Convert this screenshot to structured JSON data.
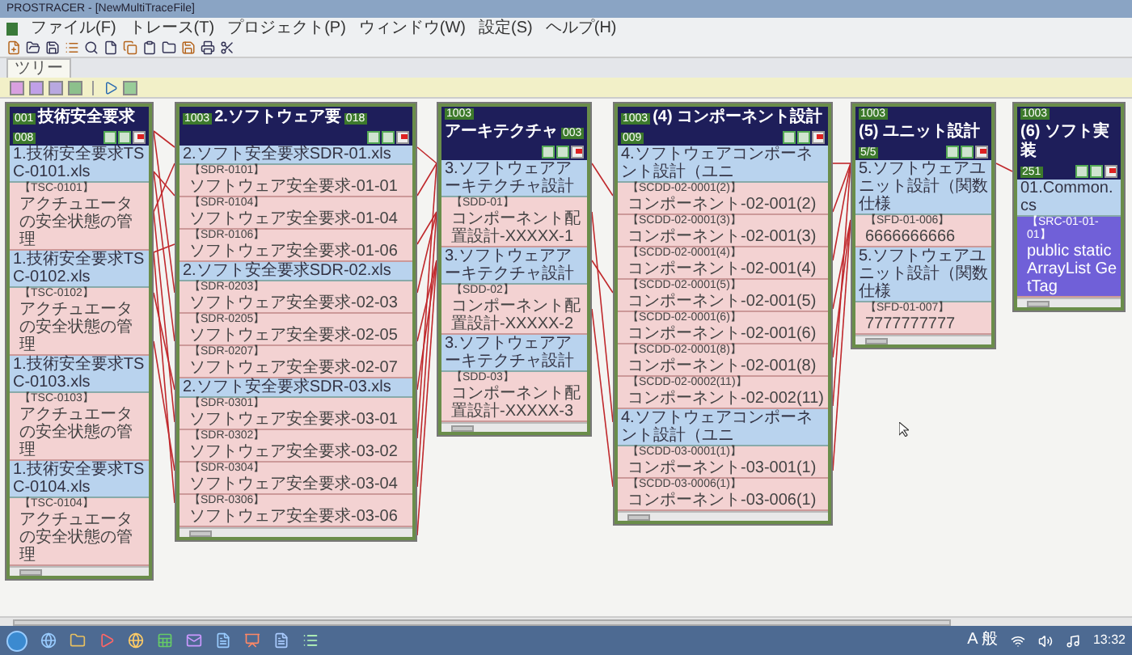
{
  "window": {
    "title": "PROSTRACER - [NewMultiTraceFile]"
  },
  "menu": [
    "ファイル(F)",
    "トレース(T)",
    "プロジェクト(P)",
    "ウィンドウ(W)",
    "設定(S)",
    "ヘルプ(H)"
  ],
  "tabs": [
    {
      "label": "ツリー",
      "selected": true
    }
  ],
  "panels": [
    {
      "badge": "001",
      "title": "技術安全要求",
      "count": "008",
      "groups": [
        {
          "label": "1.技術安全要求TSC-0101.xls",
          "items": [
            {
              "id": "【TSC-0101】",
              "name": "アクチュエータの安全状態の管理",
              "selected": false
            }
          ]
        },
        {
          "label": "1.技術安全要求TSC-0102.xls",
          "items": [
            {
              "id": "【TSC-0102】",
              "name": "アクチュエータの安全状態の管理",
              "selected": false
            }
          ]
        },
        {
          "label": "1.技術安全要求TSC-0103.xls",
          "items": [
            {
              "id": "【TSC-0103】",
              "name": "アクチュエータの安全状態の管理",
              "selected": false
            }
          ]
        },
        {
          "label": "1.技術安全要求TSC-0104.xls",
          "items": [
            {
              "id": "【TSC-0104】",
              "name": "アクチュエータの安全状態の管理",
              "selected": false
            }
          ]
        }
      ]
    },
    {
      "badge": "1003",
      "title": "2.ソフトウェア要",
      "count": "018",
      "groups": [
        {
          "label": "2.ソフト安全要求SDR-01.xls",
          "items": [
            {
              "id": "【SDR-0101】",
              "name": "ソフトウェア安全要求-01-01",
              "selected": false
            },
            {
              "id": "【SDR-0104】",
              "name": "ソフトウェア安全要求-01-04",
              "selected": false
            },
            {
              "id": "【SDR-0106】",
              "name": "ソフトウェア安全要求-01-06",
              "selected": false
            }
          ]
        },
        {
          "label": "2.ソフト安全要求SDR-02.xls",
          "items": [
            {
              "id": "【SDR-0203】",
              "name": "ソフトウェア安全要求-02-03",
              "selected": false
            },
            {
              "id": "【SDR-0205】",
              "name": "ソフトウェア安全要求-02-05",
              "selected": false
            },
            {
              "id": "【SDR-0207】",
              "name": "ソフトウェア安全要求-02-07",
              "selected": false
            }
          ]
        },
        {
          "label": "2.ソフト安全要求SDR-03.xls",
          "items": [
            {
              "id": "【SDR-0301】",
              "name": "ソフトウェア安全要求-03-01",
              "selected": false
            },
            {
              "id": "【SDR-0302】",
              "name": "ソフトウェア安全要求-03-02",
              "selected": false
            },
            {
              "id": "【SDR-0304】",
              "name": "ソフトウェア安全要求-03-04",
              "selected": false
            },
            {
              "id": "【SDR-0306】",
              "name": "ソフトウェア安全要求-03-06",
              "selected": false
            }
          ]
        }
      ]
    },
    {
      "badge": "1003",
      "title": "アーキテクチャ",
      "count": "003",
      "groups": [
        {
          "label": "3.ソフトウェアアーキテクチャ設計",
          "items": [
            {
              "id": "【SDD-01】",
              "name": "コンポーネント配置設計-XXXXX-1",
              "selected": false
            }
          ]
        },
        {
          "label": "3.ソフトウェアアーキテクチャ設計",
          "items": [
            {
              "id": "【SDD-02】",
              "name": "コンポーネント配置設計-XXXXX-2",
              "selected": false
            }
          ]
        },
        {
          "label": "3.ソフトウェアアーキテクチャ設計",
          "items": [
            {
              "id": "【SDD-03】",
              "name": "コンポーネント配置設計-XXXXX-3",
              "selected": false
            }
          ]
        }
      ]
    },
    {
      "badge": "1003",
      "title": "(4) コンポーネント設計",
      "count": "009",
      "groups": [
        {
          "label": "4.ソフトウェアコンポーネント設計（ユニ",
          "items": [
            {
              "id": "【SCDD-02-0001(2)】",
              "name": "コンポーネント-02-001(2)",
              "selected": false
            },
            {
              "id": "【SCDD-02-0001(3)】",
              "name": "コンポーネント-02-001(3)",
              "selected": false
            },
            {
              "id": "【SCDD-02-0001(4)】",
              "name": "コンポーネント-02-001(4)",
              "selected": false
            },
            {
              "id": "【SCDD-02-0001(5)】",
              "name": "コンポーネント-02-001(5)",
              "selected": false
            },
            {
              "id": "【SCDD-02-0001(6)】",
              "name": "コンポーネント-02-001(6)",
              "selected": false
            },
            {
              "id": "【SCDD-02-0001(8)】",
              "name": "コンポーネント-02-001(8)",
              "selected": false
            },
            {
              "id": "【SCDD-02-0002(11)】",
              "name": "コンポーネント-02-002(11)",
              "selected": false
            }
          ]
        },
        {
          "label": "4.ソフトウェアコンポーネント設計（ユニ",
          "items": [
            {
              "id": "【SCDD-03-0001(1)】",
              "name": "コンポーネント-03-001(1)",
              "selected": false
            },
            {
              "id": "【SCDD-03-0006(1)】",
              "name": "コンポーネント-03-006(1)",
              "selected": false
            }
          ]
        }
      ]
    },
    {
      "badge": "1003",
      "title": "(5) ユニット設計",
      "count": "5/5",
      "groups": [
        {
          "label": "5.ソフトウェアユニット設計（関数仕様",
          "items": [
            {
              "id": "【SFD-01-006】",
              "name": "6666666666",
              "selected": false
            }
          ]
        },
        {
          "label": "5.ソフトウェアユニット設計（関数仕様",
          "items": [
            {
              "id": "【SFD-01-007】",
              "name": "7777777777",
              "selected": false
            }
          ]
        }
      ]
    },
    {
      "badge": "1003",
      "title": "(6) ソフト実装",
      "count": "251",
      "groups": [
        {
          "label": "01.Common.cs",
          "items": [
            {
              "id": "【SRC-01-01-01】",
              "name": "public static ArrayList GetTag",
              "selected": true
            }
          ]
        }
      ]
    }
  ],
  "taskbar": {
    "ime": "A 般",
    "time": "13:32"
  }
}
